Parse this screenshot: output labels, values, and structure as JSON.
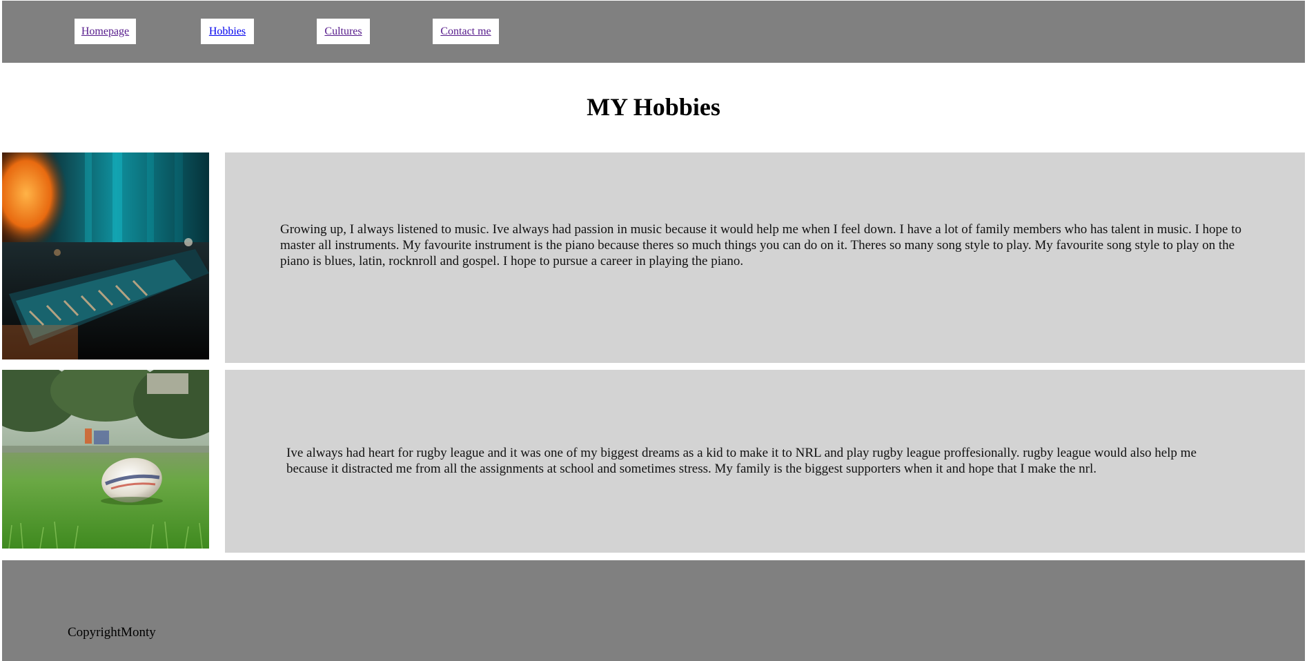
{
  "nav": {
    "items": [
      {
        "label": "Homepage"
      },
      {
        "label": "Hobbies"
      },
      {
        "label": "Cultures"
      },
      {
        "label": "Contact me"
      }
    ]
  },
  "main": {
    "title": "MY Hobbies",
    "hobbies": [
      {
        "image": "piano-keyboard-photo",
        "text": "Growing up, I always listened to music. Ive always had passion in music because it would help me when I feel down. I have a lot of family members who has talent in music. I hope to master all instruments. My favourite instrument is the piano because theres so much things you can do on it. Theres so many song style to play. My favourite song style to play on the piano is blues, latin, rocknroll and gospel. I hope to pursue a career in playing the piano."
      },
      {
        "image": "rugby-ball-on-grass-photo",
        "text": "Ive always had heart for rugby league and it was one of my biggest dreams as a kid to make it to NRL and play rugby league proffesionally. rugby league would also help me because it distracted me from all the assignments at school and sometimes stress. My family is the biggest supporters when it and hope that I make the nrl."
      }
    ]
  },
  "footer": {
    "copyright": "CopyrightMonty"
  },
  "colors": {
    "nav_background": "#808080",
    "content_background": "#d3d3d3",
    "footer_background": "#808080",
    "visited_link": "#551a8b",
    "active_link": "#0000ee"
  }
}
